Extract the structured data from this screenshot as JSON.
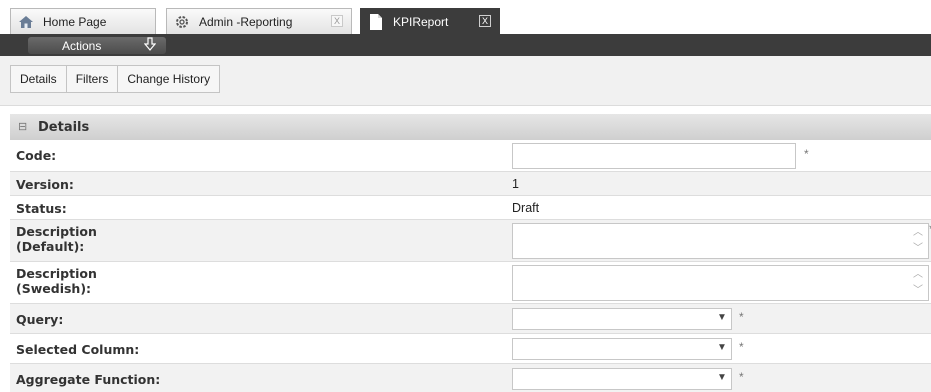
{
  "tabs": [
    {
      "label": "Home Page",
      "icon": "home-icon"
    },
    {
      "label": "Admin -Reporting",
      "icon": "gear-icon",
      "close": "X"
    },
    {
      "label": "KPIReport",
      "icon": "document-icon",
      "close": "X"
    }
  ],
  "actions": {
    "label": "Actions",
    "icon": "arrow-down-icon"
  },
  "subtabs": [
    "Details",
    "Filters",
    "Change History"
  ],
  "section": {
    "title": "Details",
    "toggle": "⊟"
  },
  "form": {
    "code": {
      "label": "Code:",
      "value": "",
      "req": "*"
    },
    "version": {
      "label": "Version:",
      "value": "1"
    },
    "status": {
      "label": "Status:",
      "value": "Draft"
    },
    "desc_default": {
      "label_1": "Description",
      "label_2": "(Default):",
      "value": "",
      "req": "*"
    },
    "desc_swedish": {
      "label_1": "Description",
      "label_2": "(Swedish):",
      "value": ""
    },
    "query": {
      "label": "Query:",
      "value": "",
      "req": "*"
    },
    "selected_column": {
      "label": "Selected Column:",
      "value": "",
      "req": "*"
    },
    "aggregate_function": {
      "label": "Aggregate Function:",
      "value": "",
      "req": "*"
    }
  },
  "colors": {
    "accent_dark": "#3c3c3c",
    "section_bg": "#dcdcdc"
  }
}
